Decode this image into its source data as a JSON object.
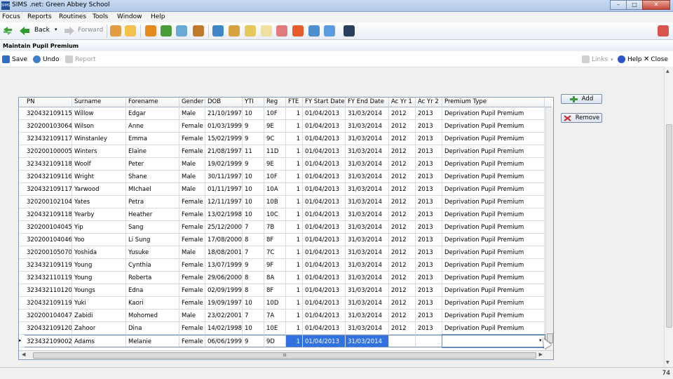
{
  "window": {
    "title": "SIMS .net: Green Abbey School",
    "app_icon": "SIMS",
    "minimize": "–",
    "maximize": "□",
    "close": "✕"
  },
  "menu": [
    "Focus",
    "Reports",
    "Routines",
    "Tools",
    "Window",
    "Help"
  ],
  "toolbar": {
    "back_label": "Back",
    "forward_label": "Forward"
  },
  "document": {
    "title": "Maintain Pupil Premium"
  },
  "commands": {
    "save": "Save",
    "undo": "Undo",
    "report": "Report",
    "links": "Links",
    "help": "Help",
    "close": "Close"
  },
  "grid": {
    "columns": [
      "PN",
      "Surname",
      "Forename",
      "Gender",
      "DOB",
      "YTI",
      "Reg",
      "FTE",
      "FY Start Date",
      "FY End Date",
      "Ac Yr 1",
      "Ac Yr 2",
      "Premium Type"
    ],
    "rows": [
      [
        "320432109115",
        "Willow",
        "Edgar",
        "Male",
        "21/10/1997",
        "10",
        "10F",
        "1",
        "01/04/2013",
        "31/03/2014",
        "2012",
        "2013",
        "Deprivation Pupil Premium"
      ],
      [
        "320200103064",
        "Wilson",
        "Anne",
        "Female",
        "01/03/1999",
        "9",
        "9E",
        "1",
        "01/04/2013",
        "31/03/2014",
        "2012",
        "2013",
        "Deprivation Pupil Premium"
      ],
      [
        "323432109117",
        "Winstanley",
        "Emma",
        "Female",
        "15/02/1999",
        "9",
        "9C",
        "1",
        "01/04/2013",
        "31/03/2014",
        "2012",
        "2013",
        "Deprivation Pupil Premium"
      ],
      [
        "320200100005",
        "Winters",
        "Elaine",
        "Female",
        "21/08/1997",
        "11",
        "11D",
        "1",
        "01/04/2013",
        "31/03/2014",
        "2012",
        "2013",
        "Deprivation Pupil Premium"
      ],
      [
        "323432109118",
        "Woolf",
        "Peter",
        "Male",
        "19/02/1999",
        "9",
        "9E",
        "1",
        "01/04/2013",
        "31/03/2014",
        "2012",
        "2013",
        "Deprivation Pupil Premium"
      ],
      [
        "320432109116",
        "Wright",
        "Shane",
        "Male",
        "30/11/1997",
        "10",
        "10F",
        "1",
        "01/04/2013",
        "31/03/2014",
        "2012",
        "2013",
        "Deprivation Pupil Premium"
      ],
      [
        "320432109117",
        "Yarwood",
        "MIchael",
        "Male",
        "01/11/1997",
        "10",
        "10A",
        "1",
        "01/04/2013",
        "31/03/2014",
        "2012",
        "2013",
        "Deprivation Pupil Premium"
      ],
      [
        "320200102104",
        "Yates",
        "Petra",
        "Female",
        "12/11/1997",
        "10",
        "10B",
        "1",
        "01/04/2013",
        "31/03/2014",
        "2012",
        "2013",
        "Deprivation Pupil Premium"
      ],
      [
        "320432109118",
        "Yearby",
        "Heather",
        "Female",
        "13/02/1998",
        "10",
        "10C",
        "1",
        "01/04/2013",
        "31/03/2014",
        "2012",
        "2013",
        "Deprivation Pupil Premium"
      ],
      [
        "320200104045",
        "Yip",
        "Sang",
        "Female",
        "25/12/2000",
        "7",
        "7B",
        "1",
        "01/04/2013",
        "31/03/2014",
        "2012",
        "2013",
        "Deprivation Pupil Premium"
      ],
      [
        "320200104046",
        "Yoo",
        "Li Sung",
        "Female",
        "17/08/2000",
        "8",
        "8F",
        "1",
        "01/04/2013",
        "31/03/2014",
        "2012",
        "2013",
        "Deprivation Pupil Premium"
      ],
      [
        "320200105070",
        "Yoshida",
        "Yusuke",
        "Male",
        "18/08/2001",
        "7",
        "7C",
        "1",
        "01/04/2013",
        "31/03/2014",
        "2012",
        "2013",
        "Deprivation Pupil Premium"
      ],
      [
        "323432109119",
        "Young",
        "Cynthia",
        "Female",
        "13/07/1999",
        "9",
        "9F",
        "1",
        "01/04/2013",
        "31/03/2014",
        "2012",
        "2013",
        "Deprivation Pupil Premium"
      ],
      [
        "323432110119",
        "Young",
        "Roberta",
        "Female",
        "29/06/2000",
        "8",
        "8A",
        "1",
        "01/04/2013",
        "31/03/2014",
        "2012",
        "2013",
        "Deprivation Pupil Premium"
      ],
      [
        "323432110120",
        "Youngs",
        "Edna",
        "Female",
        "02/09/1999",
        "8",
        "8F",
        "1",
        "01/04/2013",
        "31/03/2014",
        "2012",
        "2013",
        "Deprivation Pupil Premium"
      ],
      [
        "320432109119",
        "Yuki",
        "Kaori",
        "Female",
        "19/09/1997",
        "10",
        "10D",
        "1",
        "01/04/2013",
        "31/03/2014",
        "2012",
        "2013",
        "Deprivation Pupil Premium"
      ],
      [
        "320200104047",
        "Zabidi",
        "Mohomed",
        "Male",
        "23/02/2001",
        "7",
        "7A",
        "1",
        "01/04/2013",
        "31/03/2014",
        "2012",
        "2013",
        "Deprivation Pupil Premium"
      ],
      [
        "320432109120",
        "Zahoor",
        "Dina",
        "Female",
        "14/02/1998",
        "10",
        "10E",
        "1",
        "01/04/2013",
        "31/03/2014",
        "2012",
        "2013",
        "Deprivation Pupil Premium"
      ],
      [
        "323432109002",
        "Adams",
        "Melanie",
        "Female",
        "06/06/1999",
        "9",
        "9D",
        "1",
        "01/04/2013",
        "31/03/2014",
        "",
        "",
        ""
      ]
    ],
    "hscroll_grip": "III"
  },
  "side_buttons": {
    "add": "Add",
    "remove": "Remove"
  },
  "status": {
    "page_number": "74"
  },
  "colors": {
    "selection": "#3271e0",
    "titlebar": "#c7daf1"
  }
}
